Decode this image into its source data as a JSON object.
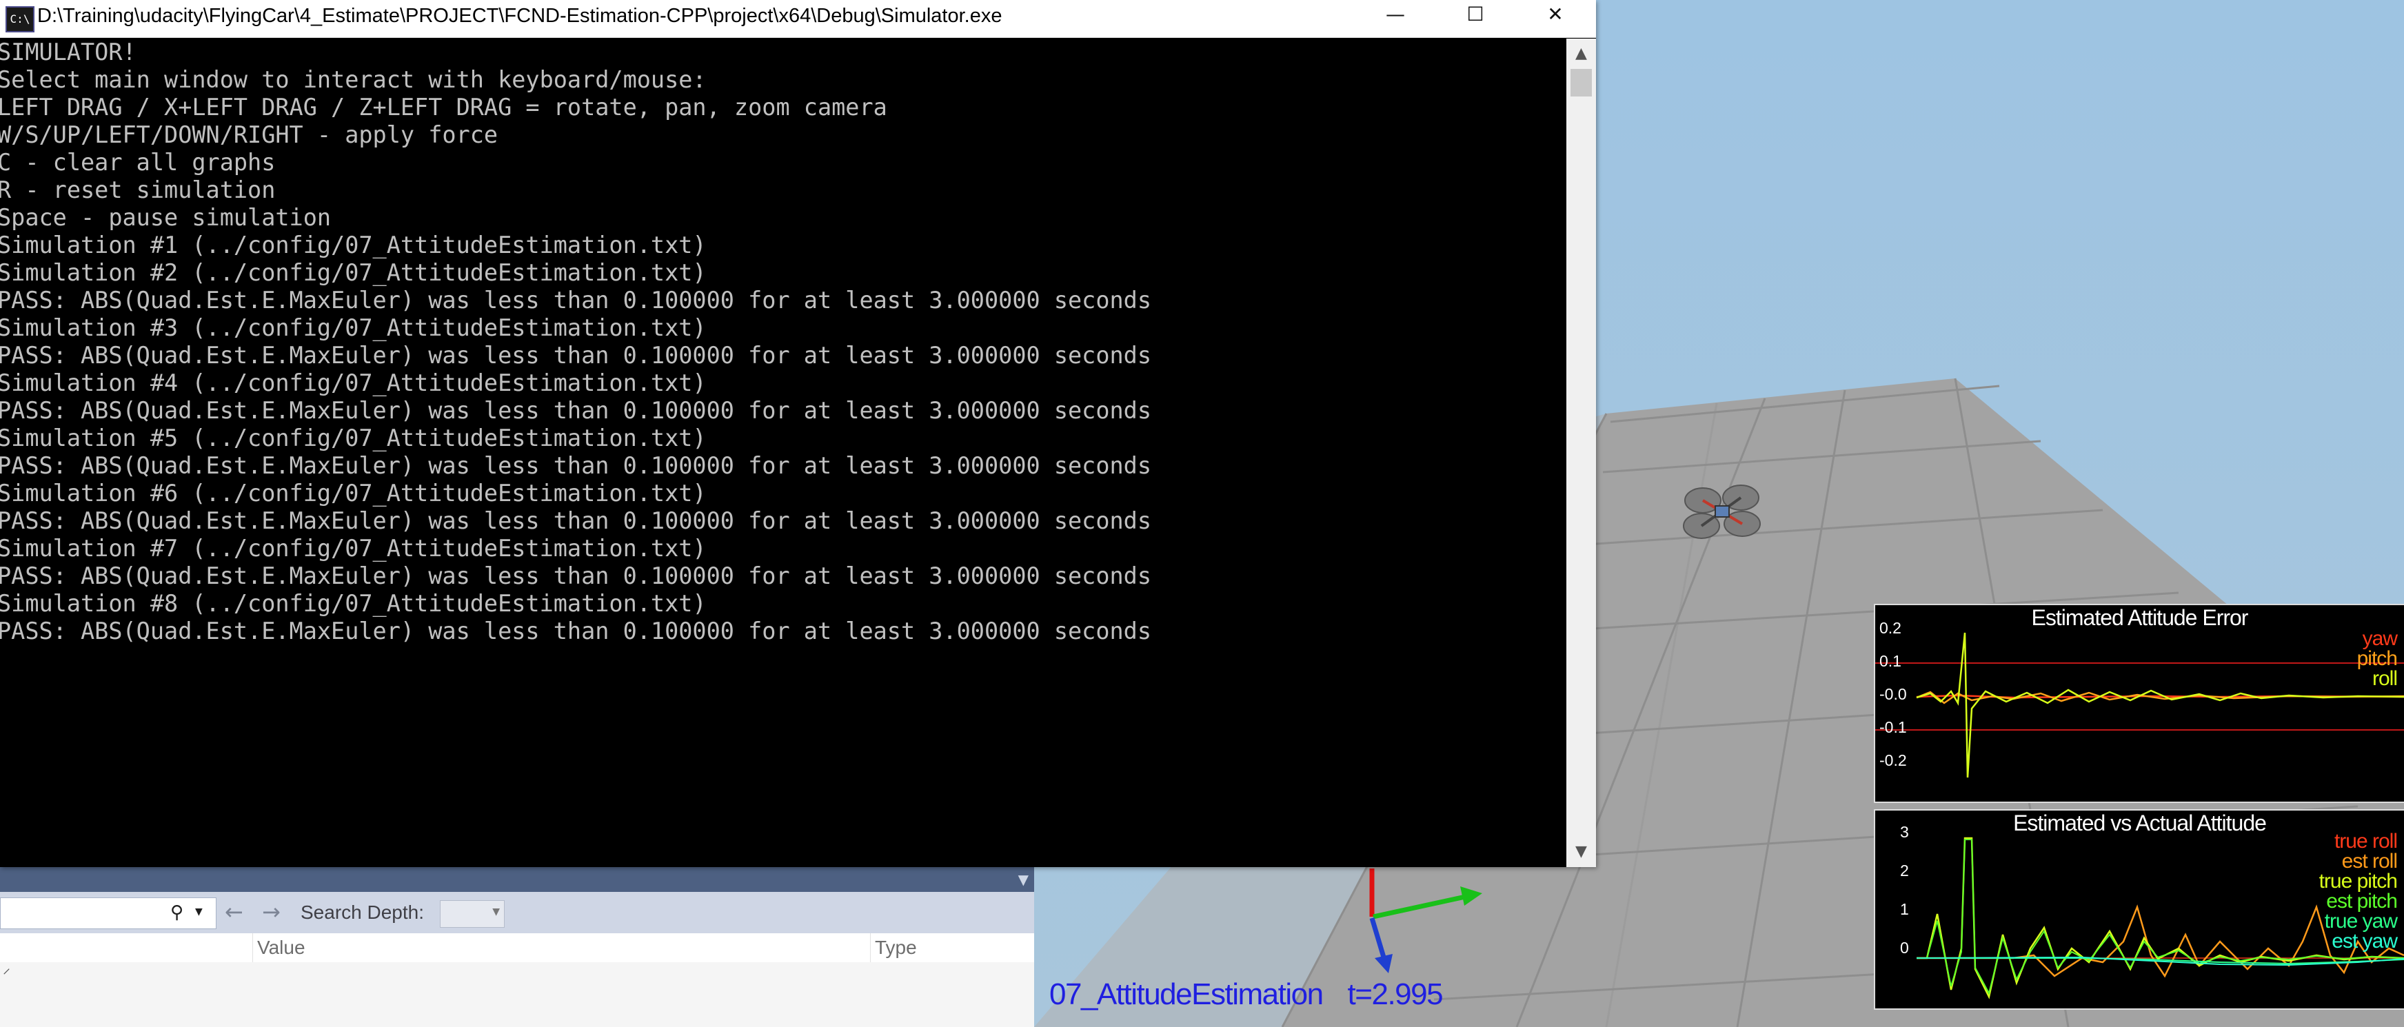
{
  "console": {
    "title": "D:\\Training\\udacity\\FlyingCar\\4_Estimate\\PROJECT\\FCND-Estimation-CPP\\project\\x64\\Debug\\Simulator.exe",
    "icon_text": "C:\\",
    "buttons": {
      "minimize": "—",
      "maximize": "☐",
      "close": "✕"
    },
    "lines": [
      "SIMULATOR!",
      "Select main window to interact with keyboard/mouse:",
      "LEFT DRAG / X+LEFT DRAG / Z+LEFT DRAG = rotate, pan, zoom camera",
      "W/S/UP/LEFT/DOWN/RIGHT - apply force",
      "C - clear all graphs",
      "R - reset simulation",
      "Space - pause simulation",
      "Simulation #1 (../config/07_AttitudeEstimation.txt)",
      "Simulation #2 (../config/07_AttitudeEstimation.txt)",
      "PASS: ABS(Quad.Est.E.MaxEuler) was less than 0.100000 for at least 3.000000 seconds",
      "Simulation #3 (../config/07_AttitudeEstimation.txt)",
      "PASS: ABS(Quad.Est.E.MaxEuler) was less than 0.100000 for at least 3.000000 seconds",
      "Simulation #4 (../config/07_AttitudeEstimation.txt)",
      "PASS: ABS(Quad.Est.E.MaxEuler) was less than 0.100000 for at least 3.000000 seconds",
      "Simulation #5 (../config/07_AttitudeEstimation.txt)",
      "PASS: ABS(Quad.Est.E.MaxEuler) was less than 0.100000 for at least 3.000000 seconds",
      "Simulation #6 (../config/07_AttitudeEstimation.txt)",
      "PASS: ABS(Quad.Est.E.MaxEuler) was less than 0.100000 for at least 3.000000 seconds",
      "Simulation #7 (../config/07_AttitudeEstimation.txt)",
      "PASS: ABS(Quad.Est.E.MaxEuler) was less than 0.100000 for at least 3.000000 seconds",
      "Simulation #8 (../config/07_AttitudeEstimation.txt)",
      "PASS: ABS(Quad.Est.E.MaxEuler) was less than 0.100000 for at least 3.000000 seconds"
    ],
    "text_color": "#c0c0c0"
  },
  "vs_panel": {
    "search_depth_label": "Search Depth:",
    "columns": [
      "Value",
      "Type"
    ],
    "header_color": "#4d6082"
  },
  "scene": {
    "scenario": "07_AttitudeEstimation",
    "time": "t=2.995",
    "label_color": "#1f1fe0"
  },
  "plots": {
    "error": {
      "title": "Estimated Attitude Error",
      "yticks": [
        "0.2",
        "0.1",
        "-0.0",
        "-0.1",
        "-0.2"
      ],
      "legend": [
        {
          "label": "yaw",
          "color": "#ff3a1a"
        },
        {
          "label": "pitch",
          "color": "#ffa21a"
        },
        {
          "label": "roll",
          "color": "#d8ff1a"
        }
      ]
    },
    "actual": {
      "title": "Estimated vs Actual Attitude",
      "yticks": [
        "3",
        "2",
        "1",
        "0"
      ],
      "legend": [
        {
          "label": "true roll",
          "color": "#ff3a1a"
        },
        {
          "label": "est roll",
          "color": "#ff9a1a"
        },
        {
          "label": "true pitch",
          "color": "#d8ff1a"
        },
        {
          "label": "est pitch",
          "color": "#5cff2a"
        },
        {
          "label": "true yaw",
          "color": "#2aff8a"
        },
        {
          "label": "est yaw",
          "color": "#2affd0"
        }
      ]
    }
  }
}
